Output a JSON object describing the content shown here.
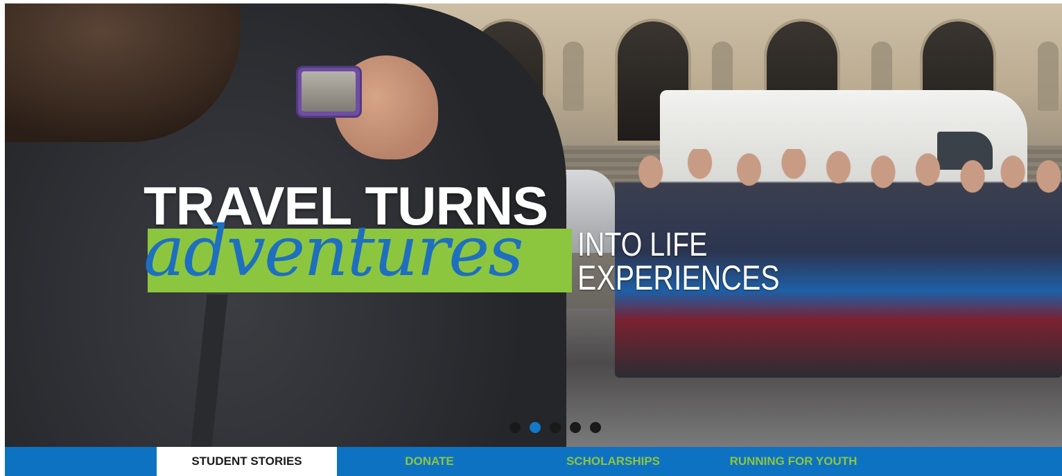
{
  "hero": {
    "headline": {
      "line1": "TRAVEL TURNS",
      "script_word": "adventures",
      "line3a": "INTO LIFE",
      "line3b": "EXPERIENCES"
    },
    "colors": {
      "band_green": "#8cc63f",
      "script_blue": "#1e6fc0"
    },
    "carousel": {
      "total_slides": 5,
      "active_slide": 2
    }
  },
  "nav": {
    "background": "#0e72c2",
    "items": [
      {
        "label": "STUDENT STORIES",
        "active": true
      },
      {
        "label": "DONATE",
        "active": false
      },
      {
        "label": "SCHOLARSHIPS",
        "active": false
      },
      {
        "label": "RUNNING FOR YOUTH",
        "active": false
      }
    ]
  }
}
